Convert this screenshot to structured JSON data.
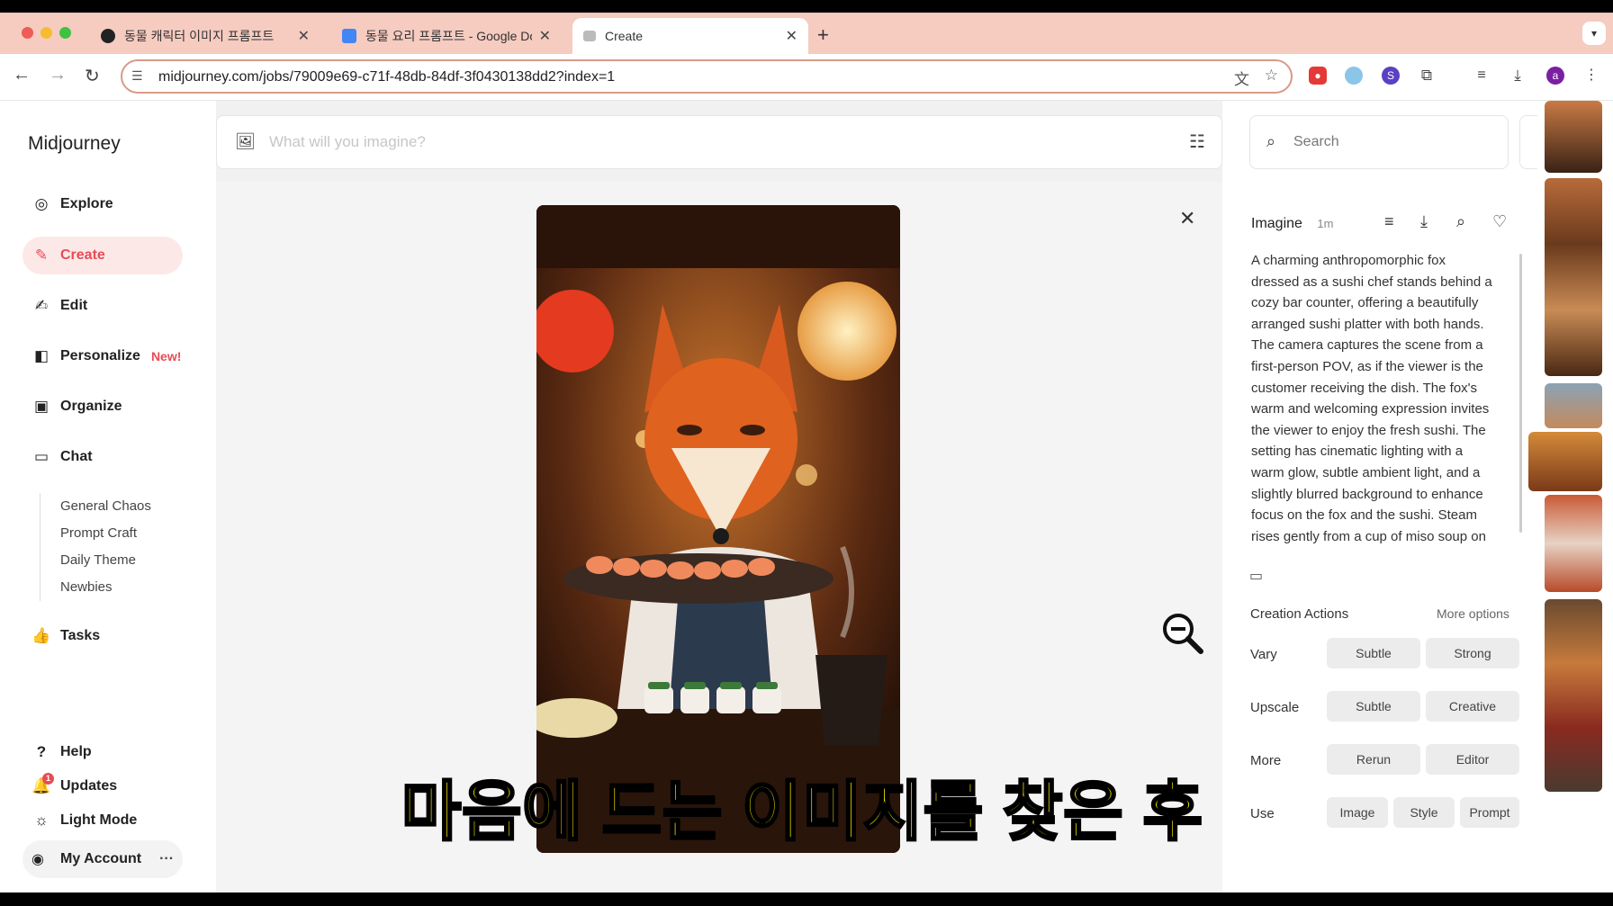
{
  "browser": {
    "tabs": [
      {
        "title": "동물 캐릭터 이미지 프롬프트",
        "icon": "openai-icon"
      },
      {
        "title": "동물 요리 프롬프트 - Google Doc",
        "icon": "docs-icon"
      },
      {
        "title": "Create",
        "icon": "midjourney-icon"
      }
    ],
    "url": "midjourney.com/jobs/79009e69-c71f-48db-84df-3f0430138dd2?index=1",
    "profile_initial": "a",
    "colors": {
      "tabstrip": "#f6cbc0",
      "accent": "#e74c56"
    }
  },
  "sidebar": {
    "brand": "Midjourney",
    "items": [
      {
        "label": "Explore",
        "icon": "compass-icon"
      },
      {
        "label": "Create",
        "icon": "brush-icon"
      },
      {
        "label": "Edit",
        "icon": "edit-icon"
      },
      {
        "label": "Personalize",
        "icon": "personalize-icon",
        "badge": "New!"
      },
      {
        "label": "Organize",
        "icon": "image-icon"
      },
      {
        "label": "Chat",
        "icon": "chat-icon"
      }
    ],
    "chat_channels": [
      "General Chaos",
      "Prompt Craft",
      "Daily Theme",
      "Newbies"
    ],
    "tasks": "Tasks",
    "help": "Help",
    "updates": "Updates",
    "light_mode": "Light Mode",
    "account": "My Account"
  },
  "main": {
    "prompt_placeholder": "What will you imagine?",
    "search_placeholder": "Search"
  },
  "details": {
    "kind": "Imagine",
    "time": "1m",
    "prompt": "A charming anthropomorphic fox dressed as a sushi chef stands behind a cozy bar counter, offering a beautifully arranged sushi platter with both hands. The camera captures the scene from a first-person POV, as if the viewer is the customer receiving the dish. The fox's warm and welcoming expression invites the viewer to enjoy the fresh sushi. The setting has cinematic lighting with a warm glow, subtle ambient light, and a slightly blurred background to enhance focus on the fox and the sushi. Steam rises gently from a cup of miso soup on the side,",
    "creation_actions": "Creation Actions",
    "more_options": "More options",
    "rows": [
      {
        "label": "Vary",
        "buttons": [
          "Subtle",
          "Strong"
        ]
      },
      {
        "label": "Upscale",
        "buttons": [
          "Subtle",
          "Creative"
        ]
      },
      {
        "label": "More",
        "buttons": [
          "Rerun",
          "Editor"
        ]
      },
      {
        "label": "Use",
        "buttons": [
          "Image",
          "Style",
          "Prompt"
        ]
      }
    ]
  },
  "subtitle": "마음에 드는 이미지를 찾은 후",
  "badge_count": "1"
}
